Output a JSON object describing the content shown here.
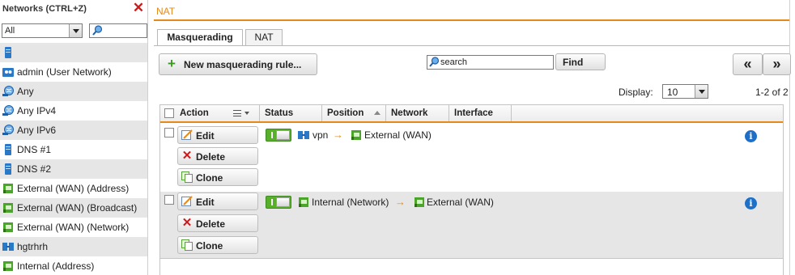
{
  "left_panel": {
    "title": "Networks (CTRL+Z)",
    "filter": {
      "selected": "All",
      "search_value": ""
    },
    "items": [
      {
        "label": "",
        "icon": "server-icon"
      },
      {
        "label": "admin (User Network)",
        "icon": "user-network-icon"
      },
      {
        "label": "Any",
        "icon": "globe-icon"
      },
      {
        "label": "Any IPv4",
        "icon": "globe-icon"
      },
      {
        "label": "Any IPv6",
        "icon": "globe-icon"
      },
      {
        "label": "DNS #1",
        "icon": "server-icon"
      },
      {
        "label": "DNS #2",
        "icon": "server-icon"
      },
      {
        "label": "External (WAN) (Address)",
        "icon": "interface-icon"
      },
      {
        "label": "External (WAN) (Broadcast)",
        "icon": "interface-icon"
      },
      {
        "label": "External (WAN) (Network)",
        "icon": "interface-icon"
      },
      {
        "label": "hgtrhrh",
        "icon": "network-icon"
      },
      {
        "label": "Internal (Address)",
        "icon": "interface-icon"
      }
    ]
  },
  "breadcrumb": "NAT",
  "tabs": [
    {
      "label": "Masquerading",
      "active": true
    },
    {
      "label": "NAT",
      "active": false
    }
  ],
  "toolbar": {
    "new_rule_label": "New masquerading rule...",
    "search_value": "search",
    "find_label": "Find",
    "prev_label": "«",
    "next_label": "»"
  },
  "pager": {
    "display_label": "Display:",
    "display_value": "10",
    "count_text": "1-2 of 2"
  },
  "table": {
    "columns": [
      "Action",
      "Status",
      "Position",
      "Network",
      "Interface"
    ],
    "action_labels": {
      "edit": "Edit",
      "delete": "Delete",
      "clone": "Clone"
    },
    "rows": [
      {
        "enabled": true,
        "network": "vpn",
        "network_icon": "network-icon",
        "interface": "External (WAN)"
      },
      {
        "enabled": true,
        "network": "Internal (Network)",
        "network_icon": "interface-icon",
        "interface": "External (WAN)"
      }
    ]
  },
  "colors": {
    "accent": "#e48a1c",
    "toggle_on": "#58b02a",
    "info": "#1e6fc7",
    "delete": "#cc1a1a"
  }
}
